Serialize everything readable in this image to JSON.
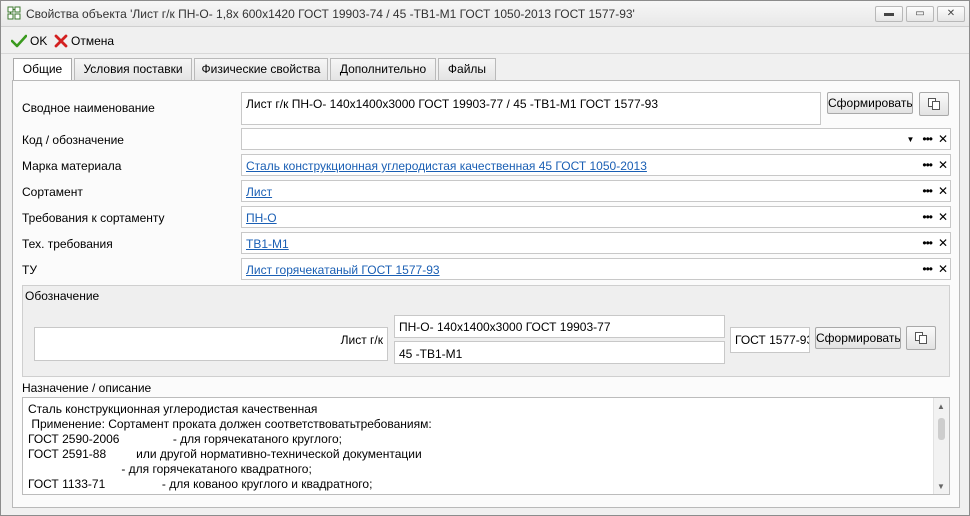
{
  "window": {
    "title": "Свойства объекта 'Лист г/к ПН-О- 1,8х 600х1420 ГОСТ 19903-74 / 45 -ТВ1-М1 ГОСТ 1050-2013 ГОСТ 1577-93'",
    "minimize": "▬",
    "maximize": "▭",
    "close": "✕"
  },
  "toolbar": {
    "ok_label": "OK",
    "cancel_label": "Отмена"
  },
  "tabs": [
    {
      "label": "Общие"
    },
    {
      "label": "Условия поставки"
    },
    {
      "label": "Физические свойства"
    },
    {
      "label": "Дополнительно"
    },
    {
      "label": "Файлы"
    }
  ],
  "general": {
    "summary_label": "Сводное наименование",
    "summary_value": "Лист г/к ПН-О- 140х1400х3000 ГОСТ 19903-77 / 45 -ТВ1-М1 ГОСТ 1577-93",
    "form_button": "Сформировать",
    "code_label": "Код / обозначение",
    "code_value": "",
    "material_label": "Марка материала",
    "material_value": "Сталь конструкционная углеродистая качественная 45 ГОСТ 1050-2013",
    "assortment_label": "Сортамент",
    "assortment_value": "Лист",
    "requirements_label": "Требования к сортаменту",
    "requirements_value": "ПН-О",
    "tech_label": "Тех. требования",
    "tech_value": "ТВ1-М1",
    "tu_label": "ТУ",
    "tu_value": "Лист горячекатаный ГОСТ 1577-93"
  },
  "designation": {
    "label": "Обозначение",
    "prefix": "Лист г/к",
    "top": "ПН-О- 140х1400х3000 ГОСТ 19903-77",
    "bottom": "45 -ТВ1-М1",
    "standard": "ГОСТ 1577-93",
    "form_button": "Сформировать"
  },
  "description": {
    "label": "Назначение / описание",
    "lines": [
      "Сталь конструкционная углеродистая качественная",
      " Применение: Сортамент проката должен соответствоватьтребованиям:",
      "ГОСТ 2590-2006                - для горячекатаного круглого;",
      "ГОСТ 2591-88         или другой нормативно-технической документации",
      "                            - для горячекатаного квадратного;",
      "ГОСТ 1133-71                 - для кованоо круглого и квадратного;"
    ]
  },
  "icons": {
    "ok": "check-icon",
    "cancel": "cross-icon",
    "copy": "copy-icon",
    "more": "ellipsis-icon",
    "clear": "clear-icon"
  },
  "colors": {
    "link": "#1a5fb4",
    "ok_green": "#3a9a1e",
    "cancel_red": "#d32020"
  }
}
